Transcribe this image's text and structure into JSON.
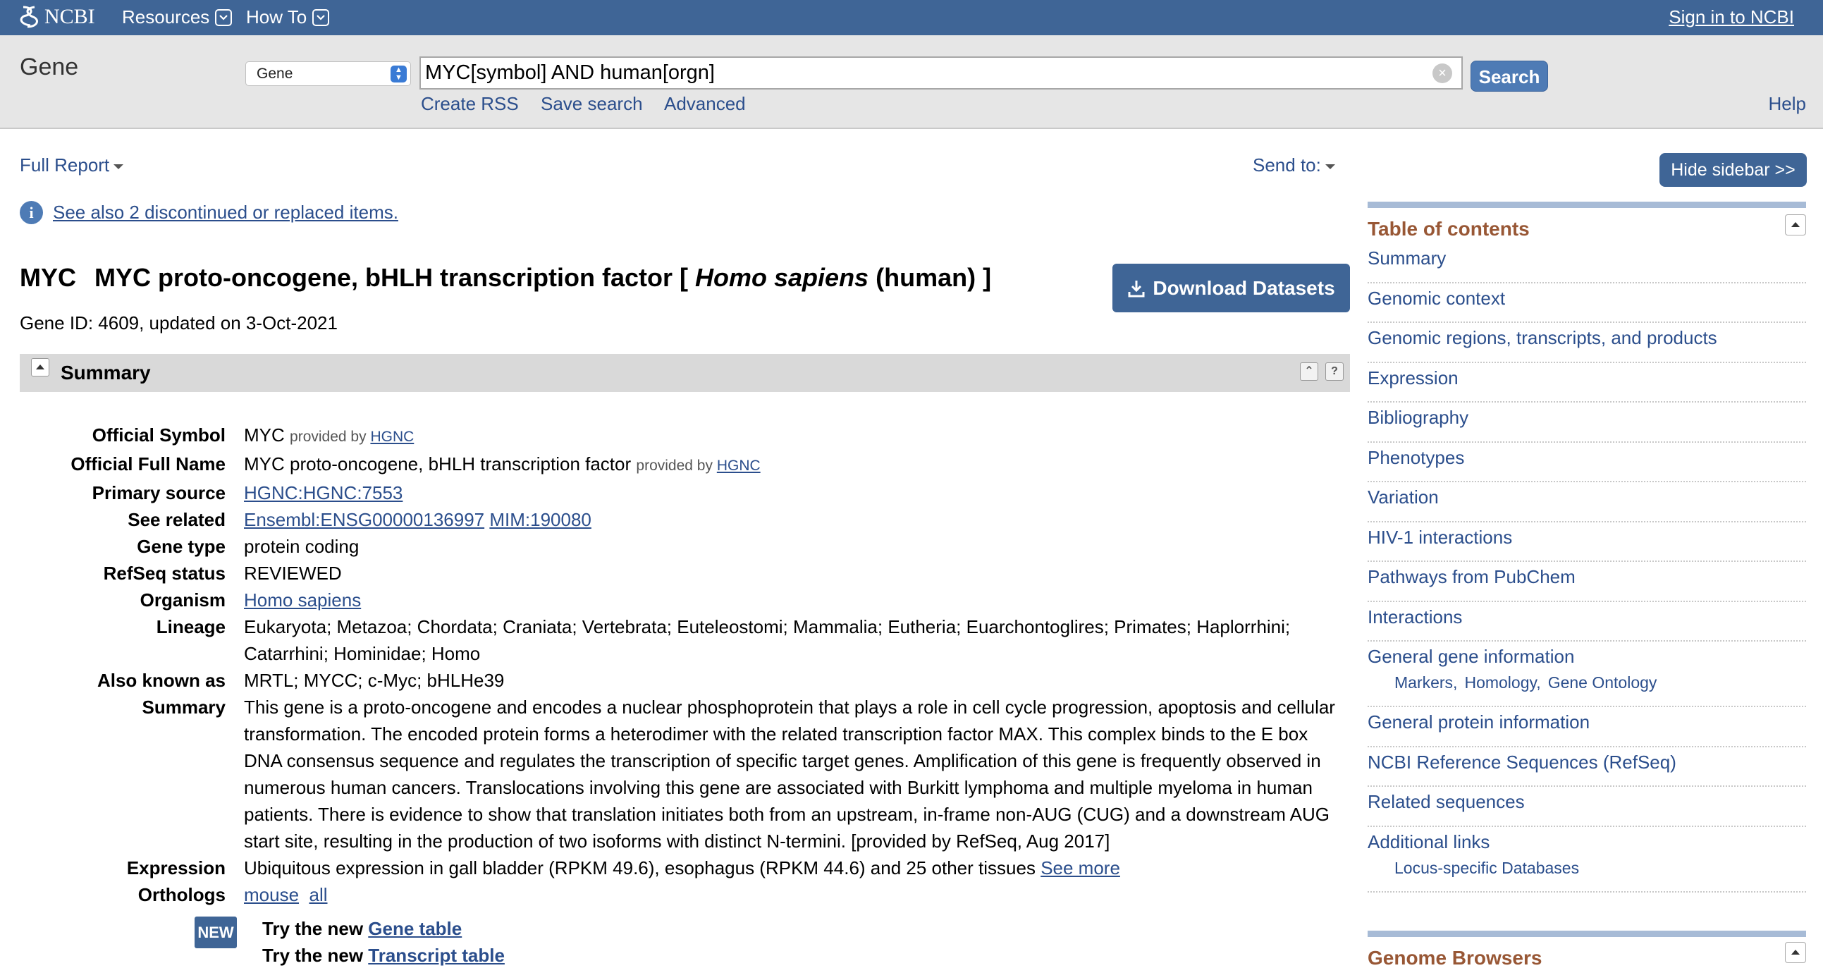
{
  "topbar": {
    "logo_text": "NCBI",
    "resources": "Resources",
    "howto": "How To",
    "signin": "Sign in to NCBI"
  },
  "search": {
    "db_title": "Gene",
    "db_selected": "Gene",
    "term": "MYC[symbol] AND human[orgn]",
    "button": "Search",
    "links": [
      "Create RSS",
      "Save search",
      "Advanced"
    ],
    "help": "Help"
  },
  "report": {
    "format": "Full Report",
    "send_to": "Send to:",
    "hide_sidebar": "Hide sidebar >>",
    "see_also": "See also 2 discontinued or replaced items."
  },
  "gene": {
    "symbol": "MYC",
    "name": "MYC proto-oncogene, bHLH transcription factor [",
    "species": "Homo sapiens",
    "common": "(human) ]",
    "id_line": "Gene ID: 4609, updated on 3-Oct-2021",
    "download": "Download Datasets"
  },
  "summary": {
    "header": "Summary",
    "provided_by": "provided by",
    "official_symbol_label": "Official Symbol",
    "official_symbol": "MYC",
    "official_symbol_source": "HGNC",
    "official_name_label": "Official Full Name",
    "official_name": "MYC proto-oncogene, bHLH transcription factor",
    "official_name_source": "HGNC",
    "primary_source_label": "Primary source",
    "primary_source": "HGNC:HGNC:7553",
    "see_related_label": "See related",
    "see_related_1": "Ensembl:ENSG00000136997",
    "see_related_2": "MIM:190080",
    "gene_type_label": "Gene type",
    "gene_type": "protein coding",
    "refseq_label": "RefSeq status",
    "refseq": "REVIEWED",
    "organism_label": "Organism",
    "organism": "Homo sapiens",
    "lineage_label": "Lineage",
    "lineage": "Eukaryota; Metazoa; Chordata; Craniata; Vertebrata; Euteleostomi; Mammalia; Eutheria; Euarchontoglires; Primates; Haplorrhini; Catarrhini; Hominidae; Homo",
    "aka_label": "Also known as",
    "aka": "MRTL; MYCC; c-Myc; bHLHe39",
    "summary_label": "Summary",
    "summary_text": "This gene is a proto-oncogene and encodes a nuclear phosphoprotein that plays a role in cell cycle progression, apoptosis and cellular transformation. The encoded protein forms a heterodimer with the related transcription factor MAX. This complex binds to the E box DNA consensus sequence and regulates the transcription of specific target genes. Amplification of this gene is frequently observed in numerous human cancers. Translocations involving this gene are associated with Burkitt lymphoma and multiple myeloma in human patients. There is evidence to show that translation initiates both from an upstream, in-frame non-AUG (CUG) and a downstream AUG start site, resulting in the production of two isoforms with distinct N-termini. [provided by RefSeq, Aug 2017]",
    "expression_label": "Expression",
    "expression": "Ubiquitous expression in gall bladder (RPKM 49.6), esophagus (RPKM 44.6) and 25 other tissues",
    "expression_link": "See more",
    "orthologs_label": "Orthologs",
    "orthologs_1": "mouse",
    "orthologs_2": "all",
    "new_badge": "NEW",
    "try_prefix": "Try the new",
    "try_gene": "Gene table",
    "try_transcript": "Transcript table"
  },
  "sidebar": {
    "toc_title": "Table of contents",
    "items": [
      "Summary",
      "Genomic context",
      "Genomic regions, transcripts, and products",
      "Expression",
      "Bibliography",
      "Phenotypes",
      "Variation",
      "HIV-1 interactions",
      "Pathways from PubChem",
      "Interactions",
      "General gene information",
      "General protein information",
      "NCBI Reference Sequences (RefSeq)",
      "Related sequences",
      "Additional links"
    ],
    "gene_info_sub": [
      "Markers,",
      "Homology,",
      "Gene Ontology"
    ],
    "additional_sub": "Locus-specific Databases",
    "genome_browsers": "Genome Browsers"
  }
}
